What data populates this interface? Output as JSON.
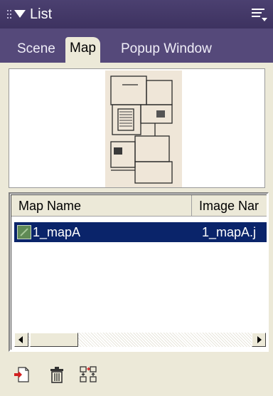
{
  "panel": {
    "title": "List"
  },
  "tabs": [
    {
      "label": "Scene",
      "active": false
    },
    {
      "label": "Map",
      "active": true
    },
    {
      "label": "Popup Window",
      "active": false
    }
  ],
  "table": {
    "columns": [
      "Map Name",
      "Image Nar"
    ],
    "rows": [
      {
        "name": "1_mapA",
        "image": "1_mapA.j",
        "selected": true
      }
    ]
  },
  "toolbar": {
    "buttons": [
      {
        "icon": "new-map-icon"
      },
      {
        "icon": "trash-icon"
      },
      {
        "icon": "swap-order-icon"
      }
    ]
  },
  "colors": {
    "selection": "#0a246a",
    "panel_bg": "#3a2f55",
    "content_bg": "#ece9d8"
  }
}
